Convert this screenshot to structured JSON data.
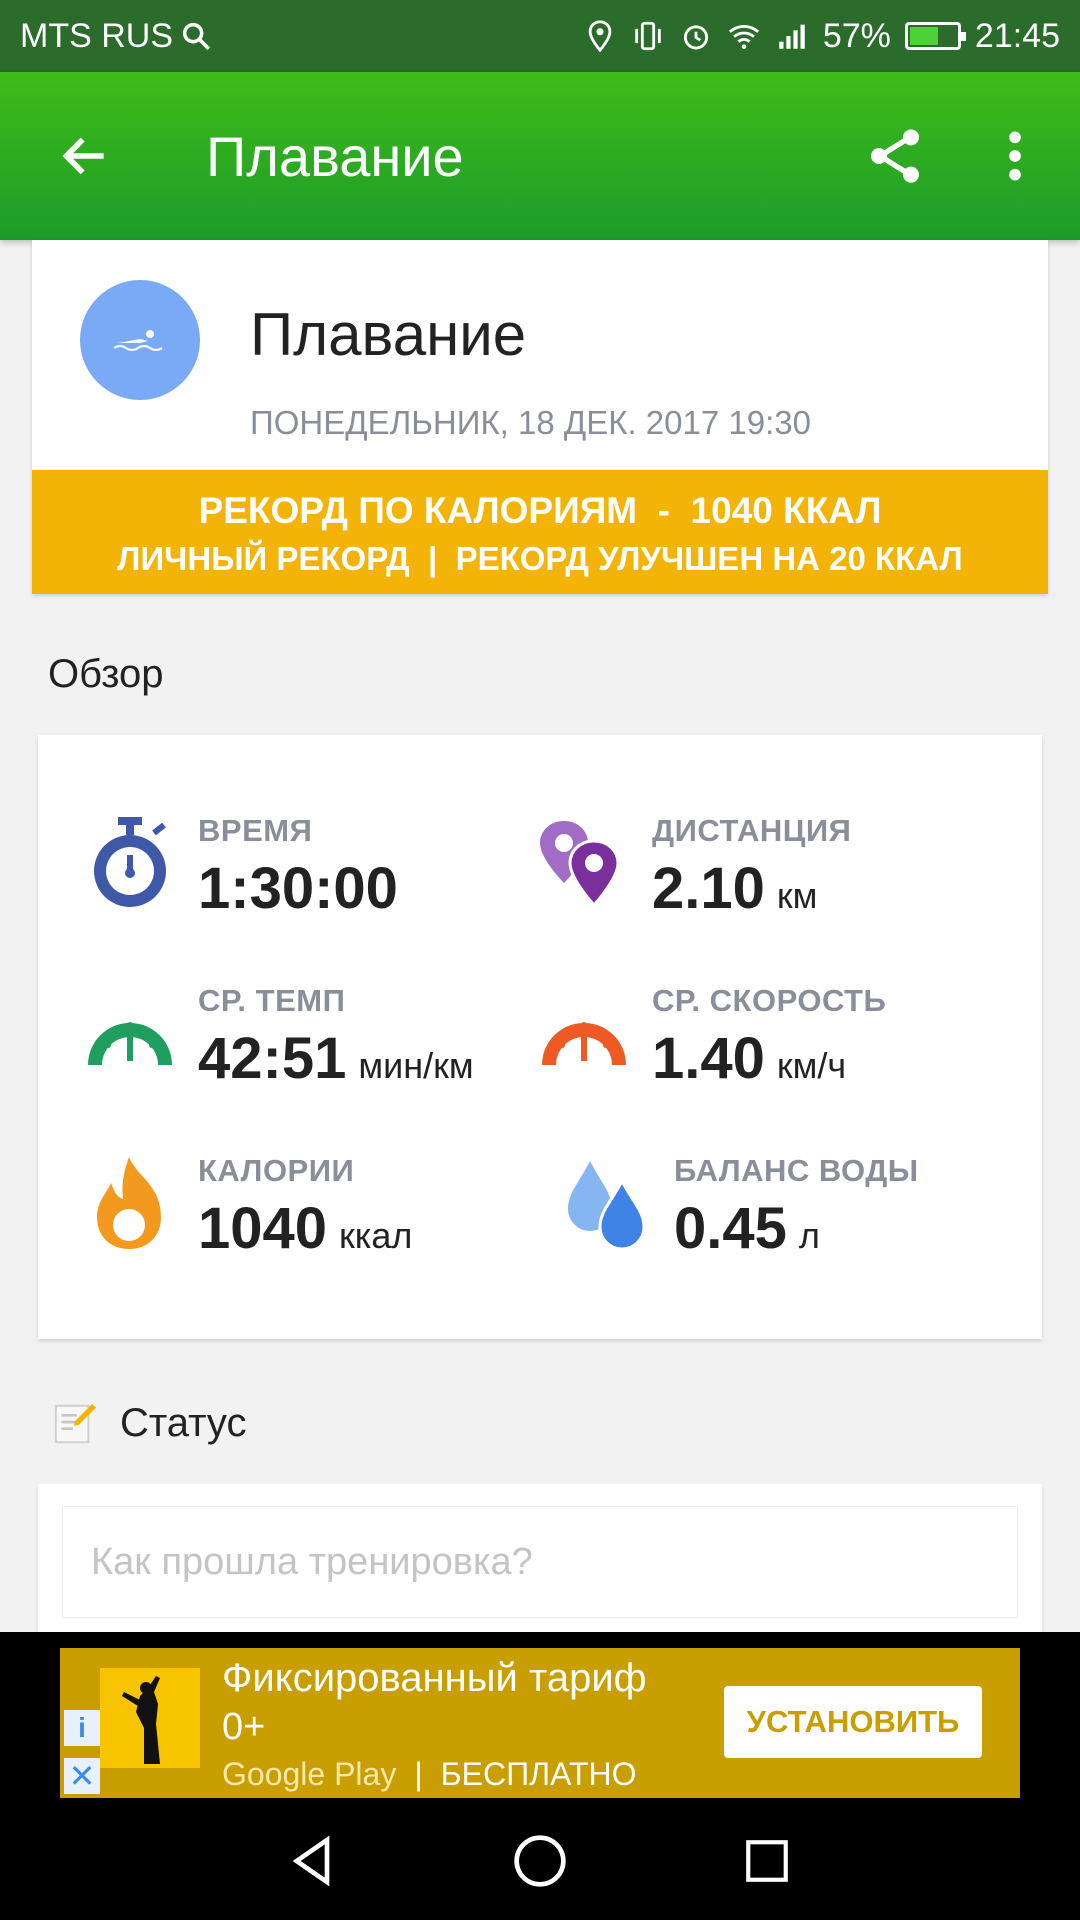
{
  "status_bar": {
    "carrier": "MTS RUS",
    "battery": "57%",
    "time": "21:45"
  },
  "app_bar": {
    "title": "Плавание"
  },
  "activity": {
    "title": "Плавание",
    "datetime": "ПОНЕДЕЛЬНИК, 18 ДЕК. 2017 19:30",
    "record_line1": "РЕКОРД ПО КАЛОРИЯМ  -  1040 ККАЛ",
    "record_line2": "ЛИЧНЫЙ РЕКОРД  |  РЕКОРД УЛУЧШЕН НА 20 ККАЛ"
  },
  "overview": {
    "title": "Обзор",
    "stats": {
      "time": {
        "label": "ВРЕМЯ",
        "value": "1:30:00",
        "unit": ""
      },
      "distance": {
        "label": "ДИСТАНЦИЯ",
        "value": "2.10",
        "unit": "км"
      },
      "pace": {
        "label": "СР. ТЕМП",
        "value": "42:51",
        "unit": "мин/км"
      },
      "speed": {
        "label": "СР. СКОРОСТЬ",
        "value": "1.40",
        "unit": "км/ч"
      },
      "calories": {
        "label": "КАЛОРИИ",
        "value": "1040",
        "unit": "ккал"
      },
      "water": {
        "label": "БАЛАНС ВОДЫ",
        "value": "0.45",
        "unit": "л"
      }
    }
  },
  "status": {
    "title": "Статус",
    "placeholder": "Как прошла тренировка?"
  },
  "ad": {
    "title": "Фиксированный тариф",
    "age": "0+",
    "store": "Google Play",
    "price": "БЕСПЛАТНО",
    "install_label": "УСТАНОВИТЬ"
  },
  "colors": {
    "appbar": "#2aa824",
    "record": "#f3b407",
    "avatar": "#7aa9f5"
  }
}
